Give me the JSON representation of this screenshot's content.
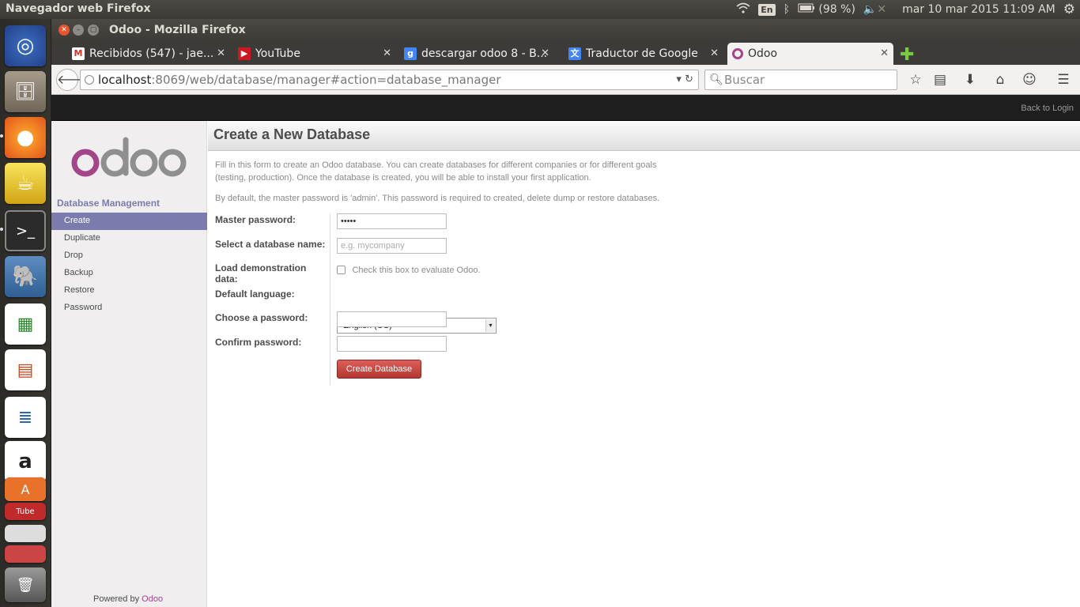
{
  "system": {
    "app_name": "Navegador web Firefox",
    "keyboard": "En",
    "battery": "(98 %)",
    "datetime": "mar 10 mar 2015 11:09 AM"
  },
  "window": {
    "title": "Odoo - Mozilla Firefox"
  },
  "tabs": [
    {
      "label": "Recibidos (547) - jae...",
      "icon": "gmail-icon",
      "color": "#d93025"
    },
    {
      "label": "YouTube",
      "icon": "youtube-icon",
      "color": "#cc181e"
    },
    {
      "label": "descargar odoo 8 - B...",
      "icon": "google-icon",
      "color": "#4285f4"
    },
    {
      "label": "Traductor de Google",
      "icon": "translate-icon",
      "color": "#4285f4"
    },
    {
      "label": "Odoo",
      "icon": "odoo-icon",
      "color": "#a24689",
      "active": true
    }
  ],
  "urlbar": {
    "host": "localhost",
    "rest": ":8069/web/database/manager#action=database_manager"
  },
  "searchbar": {
    "placeholder": "Buscar"
  },
  "page_header": {
    "back_to_login": "Back to Login"
  },
  "sidebar": {
    "heading": "Database Management",
    "items": [
      "Create",
      "Duplicate",
      "Drop",
      "Backup",
      "Restore",
      "Password"
    ],
    "active": "Create",
    "powered_prefix": "Powered by",
    "powered_brand": "Odoo"
  },
  "main": {
    "title": "Create a New Database",
    "help_1": "Fill in this form to create an Odoo database. You can create databases for different companies or for different goals (testing, production). Once the database is created, you will be able to install your first application.",
    "help_2": "By default, the master password is 'admin'. This password is required to created, delete dump or restore databases.",
    "labels": {
      "master_password": "Master password:",
      "db_name": "Select a database name:",
      "demo_data": "Load demonstration data:",
      "language": "Default language:",
      "password": "Choose a password:",
      "confirm": "Confirm password:"
    },
    "values": {
      "master_password": "•••••",
      "db_name_placeholder": "e.g. mycompany",
      "demo_hint": "Check this box to evaluate Odoo.",
      "language": "English (US)"
    },
    "submit": "Create Database"
  }
}
